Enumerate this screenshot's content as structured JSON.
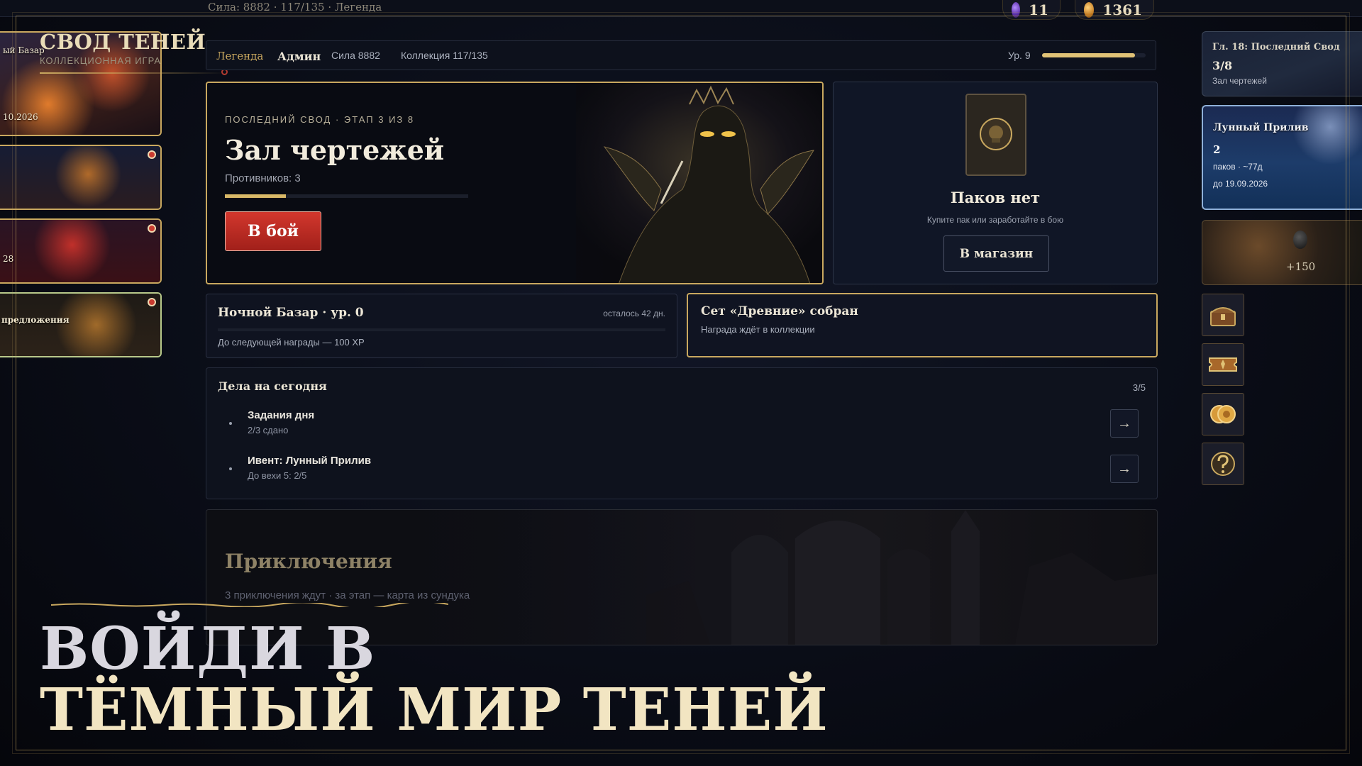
{
  "topbar": {
    "status": "Сила: 8882 · 117/135 · Легенда",
    "gems": "11",
    "coins": "1361"
  },
  "logo": {
    "title": "СВОД ТЕНЕЙ",
    "subtitle": "КОЛЛЕКЦИОННАЯ ИГРА"
  },
  "left_cards": [
    {
      "label": "ый Базар",
      "date": "10.2026"
    },
    {
      "label": ""
    },
    {
      "label": "28"
    },
    {
      "label": "предложения"
    }
  ],
  "profile_bar": {
    "rank": "Легенда",
    "name": "Админ",
    "power": "Сила 8882",
    "collection": "Коллекция 117/135",
    "level": "Ур. 9",
    "level_progress": 0.9
  },
  "hero": {
    "subtitle": "ПОСЛЕДНИЙ СВОД · ЭТАП 3 ИЗ 8",
    "title": "Зал чертежей",
    "enemies": "Противников: 3",
    "progress": 0.25,
    "fight_button": "В бой"
  },
  "packs": {
    "title": "Паков нет",
    "hint": "Купите пак или заработайте в бою",
    "shop_button": "В магазин"
  },
  "bazaar": {
    "title": "Ночной Базар · ур. 0",
    "remaining": "осталось 42 дн.",
    "next_reward": "До следующей награды — 100 XP",
    "progress": 0.0
  },
  "set_card": {
    "title": "Сет «Древние» собран",
    "subtitle": "Награда ждёт в коллекции"
  },
  "todo": {
    "title": "Дела на сегодня",
    "count": "3/5",
    "items": [
      {
        "name": "Задания дня",
        "detail": "2/3 сдано",
        "action": "→"
      },
      {
        "name": "Ивент: Лунный Прилив",
        "detail": "До вехи 5: 2/5",
        "action": "→"
      }
    ]
  },
  "adventures": {
    "title": "Приключения",
    "subtitle": "3 приключения ждут · за этап — карта из сундука"
  },
  "right_cards": [
    {
      "title": "Гл. 18: Последний Свод",
      "value": "3/8",
      "caption": "Зал чертежей"
    },
    {
      "title": "Лунный Прилив",
      "value": "2",
      "caption": "паков · ~77д",
      "date": "до 19.09.2026"
    },
    {
      "reward": "+150"
    }
  ],
  "right_icons": [
    "chest-icon",
    "ticket-icon",
    "coins-icon",
    "help-icon"
  ],
  "headline": {
    "line1": "ВОЙДИ В",
    "line2": "ТЁМНЫЙ МИР ТЕНЕЙ"
  },
  "colors": {
    "gold": "#c9a85f",
    "accent_red": "#c93b30",
    "background": "#0a0d17"
  }
}
